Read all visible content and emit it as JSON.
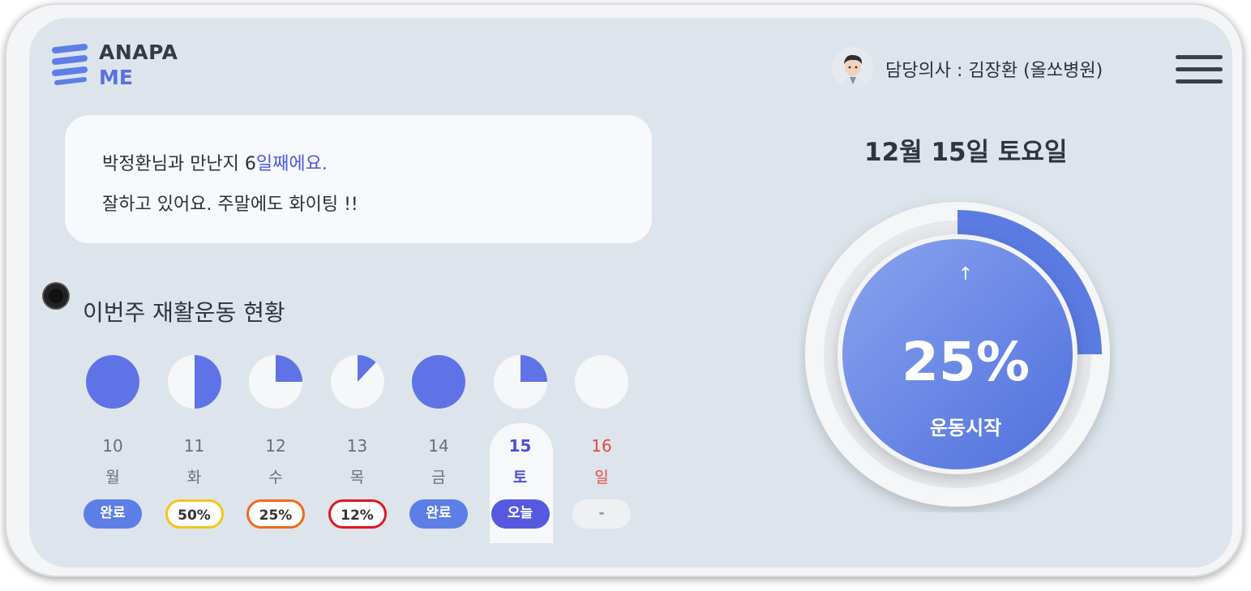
{
  "app": {
    "logo_line1": "ANAPA",
    "logo_line2": "ME"
  },
  "header": {
    "doctor_text": "담당의사 : 김장환 (올쏘병원)",
    "avatar_icon": "doctor-avatar-icon",
    "menu_icon": "hamburger-menu-icon"
  },
  "message": {
    "line1_prefix": "박정환님과 만난지 6",
    "line1_highlight": "일째에요.",
    "line2": "잘하고 있어요. 주말에도 화이팅 !!"
  },
  "section": {
    "title": "이번주 재활운동 현황"
  },
  "week": [
    {
      "date": "10",
      "day": "월",
      "progress": 1.0,
      "status": "완료",
      "type": "done"
    },
    {
      "date": "11",
      "day": "화",
      "progress": 0.5,
      "status": "50%",
      "type": "ring",
      "ring_color": "#f5c518"
    },
    {
      "date": "12",
      "day": "수",
      "progress": 0.25,
      "status": "25%",
      "type": "ring",
      "ring_color": "#ee6a1c"
    },
    {
      "date": "13",
      "day": "목",
      "progress": 0.12,
      "status": "12%",
      "type": "ring",
      "ring_color": "#e0161f"
    },
    {
      "date": "14",
      "day": "금",
      "progress": 1.0,
      "status": "완료",
      "type": "done"
    },
    {
      "date": "15",
      "day": "토",
      "progress": 0.25,
      "status": "오늘",
      "type": "today"
    },
    {
      "date": "16",
      "day": "일",
      "progress": 0,
      "status": "-",
      "type": "none"
    }
  ],
  "today": {
    "date_label": "12월 15일 토요일",
    "progress": 0.25,
    "percent_text": "25%",
    "action_label": "운동시작",
    "arrow": "↑"
  },
  "colors": {
    "accent": "#5d6ee8",
    "today_text": "#4a4fd8",
    "sunday": "#e84545",
    "background": "#dde4ec"
  }
}
